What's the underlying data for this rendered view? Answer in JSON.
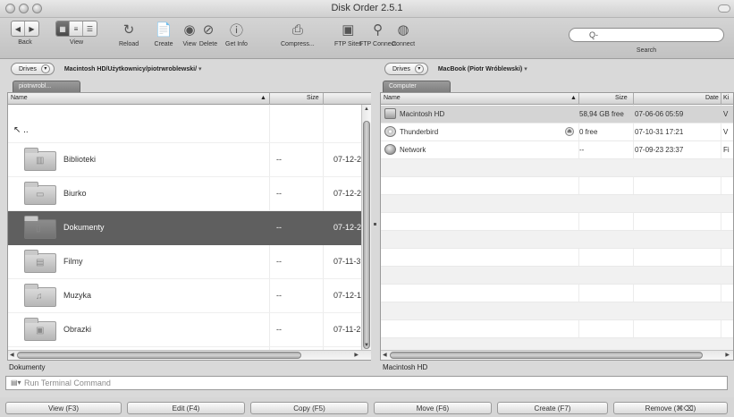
{
  "window": {
    "title": "Disk Order 2.5.1"
  },
  "toolbar": {
    "back_label": "Back",
    "view_label": "View",
    "reload_label": "Reload",
    "create_label": "Create",
    "view2_label": "View",
    "delete_label": "Delete",
    "getinfo_label": "Get Info",
    "compress_label": "Compress...",
    "ftpsites_label": "FTP Sites",
    "ftpconnect_label": "FTP Connect",
    "connect_label": "Connect",
    "search_label": "Search",
    "search_value": "Q-"
  },
  "left": {
    "drives_label": "Drives",
    "path": "Macintosh HD/Użytkownicy/piotrwroblewski/",
    "path_caret": "▾",
    "tab": "piotrwrobl...",
    "col_name": "Name",
    "col_size": "Size",
    "up_label": "↖ ..",
    "rows": [
      {
        "name": "Biblioteki",
        "size": "--",
        "date": "07-12-2",
        "glyph": "▥"
      },
      {
        "name": "Biurko",
        "size": "--",
        "date": "07-12-2",
        "glyph": "▭"
      },
      {
        "name": "Dokumenty",
        "size": "--",
        "date": "07-12-2",
        "glyph": "▯"
      },
      {
        "name": "Filmy",
        "size": "--",
        "date": "07-11-3",
        "glyph": "▤"
      },
      {
        "name": "Muzyka",
        "size": "--",
        "date": "07-12-1",
        "glyph": "♫"
      },
      {
        "name": "Obrazki",
        "size": "--",
        "date": "07-11-2",
        "glyph": "▣"
      }
    ],
    "status": "Dokumenty"
  },
  "right": {
    "drives_label": "Drives",
    "path": "MacBook (Piotr Wróblewski)",
    "path_caret": "▾",
    "tab": "Computer",
    "col_name": "Name",
    "col_size": "Size",
    "col_date": "Date",
    "col_kind": "Ki",
    "rows": [
      {
        "name": "Macintosh HD",
        "size": "58,94 GB free",
        "date": "07-06-06 05:59",
        "kind": "V"
      },
      {
        "name": "Thunderbird",
        "size": "0 free",
        "date": "07-10-31 17:21",
        "kind": "V"
      },
      {
        "name": "Network",
        "size": "--",
        "date": "07-09-23 23:37",
        "kind": "Fi"
      }
    ],
    "status": "Macintosh HD"
  },
  "command": {
    "placeholder": "Run Terminal Command"
  },
  "fkeys": {
    "view": "View (F3)",
    "edit": "Edit (F4)",
    "copy": "Copy (F5)",
    "move": "Move (F6)",
    "create": "Create (F7)",
    "remove": "Remove (⌘⌫)"
  },
  "colors": {
    "selection": "#5f5f5f",
    "toolbar": "#c8c8c8"
  }
}
